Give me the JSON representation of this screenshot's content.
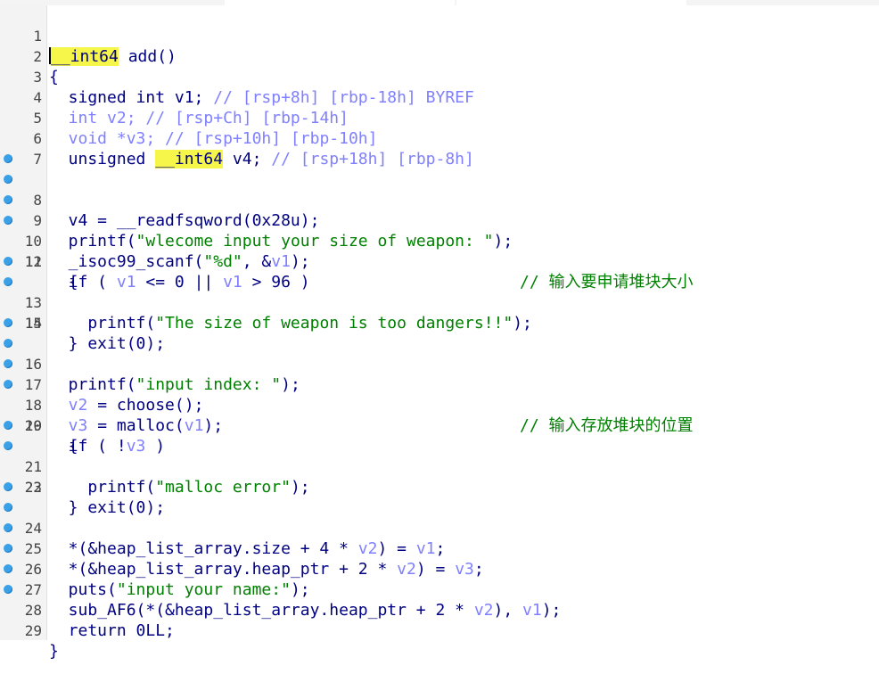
{
  "line_numbers": [
    "1",
    "2",
    "3",
    "4",
    "5",
    "6",
    "7",
    "8",
    "9",
    "10",
    "11",
    "12",
    "13",
    "14",
    "15",
    "16",
    "17",
    "18",
    "19",
    "20",
    "21",
    "22",
    "23",
    "24",
    "25",
    "26",
    "27",
    "28",
    "29"
  ],
  "breakpoint_lines": [
    8,
    9,
    10,
    11,
    13,
    14,
    16,
    17,
    18,
    19,
    21,
    22,
    24,
    25,
    26,
    27,
    28,
    29
  ],
  "code": {
    "l1": {
      "type": "__int64",
      "rest": " add()"
    },
    "l2": "{",
    "l3": {
      "decl": "  signed int v1; ",
      "comment": "// [rsp+8h] [rbp-18h] BYREF"
    },
    "l4": {
      "decl": "  int v2; ",
      "comment": "// [rsp+Ch] [rbp-14h]"
    },
    "l5": {
      "decl": "  void *v3; ",
      "comment": "// [rsp+10h] [rbp-10h]"
    },
    "l6": {
      "pre": "  unsigned ",
      "type": "__int64",
      "decl": " v4; ",
      "comment": "// [rsp+18h] [rbp-8h]"
    },
    "l8": "  v4 = __readfsqword(0x28u);",
    "l9": {
      "pre": "  printf(",
      "str": "\"wlecome input your size of weapon: \"",
      "post": ");"
    },
    "l10": {
      "pre": "  _isoc99_scanf(",
      "str": "\"%d\"",
      "mid": ", &",
      "var": "v1",
      "post": ");",
      "comment": "// 输入要申请堆块大小"
    },
    "l11": {
      "pre": "  if ( ",
      "v1a": "v1",
      "mid1": " <= 0 || ",
      "v1b": "v1",
      "post": " > 96 )"
    },
    "l12": "  {",
    "l13": {
      "pre": "    printf(",
      "str": "\"The size of weapon is too dangers!!\"",
      "post": ");"
    },
    "l14": "    exit(0);",
    "l15": "  }",
    "l16": {
      "pre": "  printf(",
      "str": "\"input index: \"",
      "post": ");"
    },
    "l17": {
      "var": "  v2",
      "post": " = choose();",
      "comment": "// 输入存放堆块的位置"
    },
    "l18": {
      "var": "  v3",
      "mid": " = malloc(",
      "var2": "v1",
      "post": ");"
    },
    "l19": {
      "pre": "  if ( !",
      "var": "v3",
      "post": " )"
    },
    "l20": "  {",
    "l21": {
      "pre": "    printf(",
      "str": "\"malloc error\"",
      "post": ");"
    },
    "l22": "    exit(0);",
    "l23": "  }",
    "l24": {
      "pre": "  *(&heap_list_array.size + 4 * ",
      "var": "v2",
      "mid": ") = ",
      "var2": "v1",
      "post": ";"
    },
    "l25": {
      "pre": "  *(&heap_list_array.heap_ptr + 2 * ",
      "var": "v2",
      "mid": ") = ",
      "var2": "v3",
      "post": ";"
    },
    "l26": {
      "pre": "  puts(",
      "str": "\"input your name:\"",
      "post": ");"
    },
    "l27": {
      "pre": "  sub_AF6(*(&heap_list_array.heap_ptr + 2 * ",
      "var": "v2",
      "mid": "), ",
      "var2": "v1",
      "post": ");"
    },
    "l28": "  return 0LL;",
    "l29": "}"
  },
  "colors": {
    "keyword": "#000080",
    "string": "#008000",
    "variable": "#8080ff",
    "highlight": "#f5f54a",
    "breakpoint": "#3aa0e8"
  },
  "icons": {
    "breakpoint": "breakpoint-dot-icon"
  }
}
